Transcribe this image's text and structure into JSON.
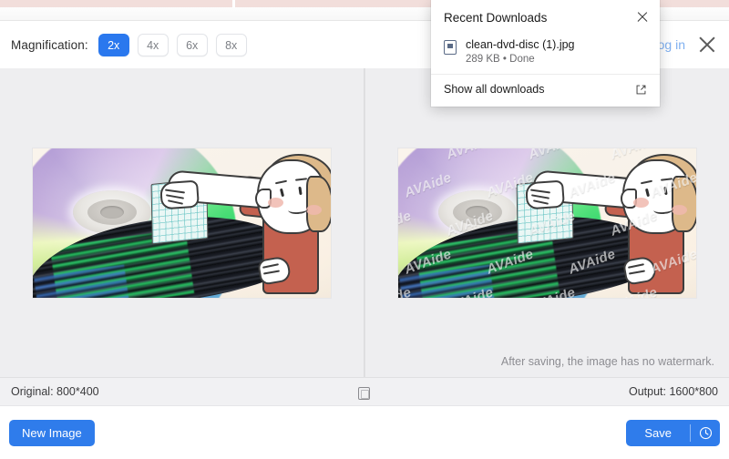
{
  "browser": {
    "downloads_panel": {
      "title": "Recent Downloads",
      "close_icon": "close-icon",
      "file_icon": "file-image-icon",
      "filename": "clean-dvd-disc (1).jpg",
      "file_meta": "289 KB • Done",
      "show_all_label": "Show all downloads",
      "external_link_icon": "external-link-icon"
    }
  },
  "app": {
    "header": {
      "magnification_label": "Magnification:",
      "magnification_options": [
        {
          "label": "2x",
          "selected": true
        },
        {
          "label": "4x",
          "selected": false
        },
        {
          "label": "6x",
          "selected": false
        },
        {
          "label": "8x",
          "selected": false
        }
      ],
      "login_label": "Log in",
      "close_icon": "close-icon"
    },
    "preview": {
      "left_pane_name": "original-image-preview",
      "right_pane_name": "upscaled-image-preview",
      "watermark_text": "AVAide",
      "watermark_note": "After saving, the image has no watermark."
    },
    "statusbar": {
      "original_label": "Original: 800*400",
      "output_label": "Output: 1600*800",
      "compare_icon": "compare-view-icon"
    },
    "footer": {
      "new_image_label": "New Image",
      "save_label": "Save",
      "history_icon": "clock-history-icon"
    }
  },
  "colors": {
    "accent": "#2f7ceb",
    "accent_active": "#2a78ee",
    "preview_bg": "#eeeef0",
    "statusbar_bg": "#f1f1f3",
    "muted_text": "#8d8d92",
    "login_link": "#7fb0f0"
  }
}
